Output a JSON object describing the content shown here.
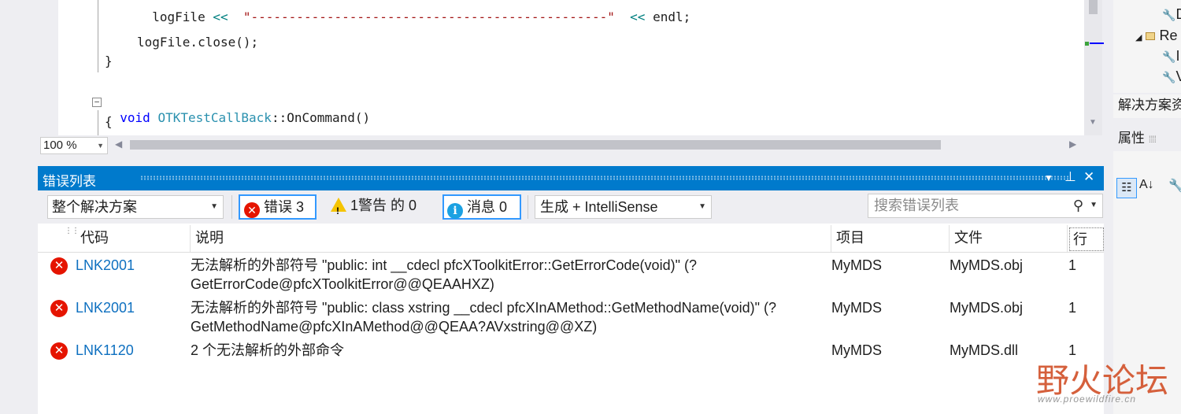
{
  "editor": {
    "lines": [
      {
        "text_ident": "logFile",
        "text_op": "<<",
        "text_dashes": "\"-----------------------------------------------\"",
        "text_op2": "<<",
        "text_end": "endl;"
      },
      {
        "text": "logFile.close();"
      },
      {
        "text": "}"
      },
      {
        "kw": "void",
        "type": "OTKTestCallBack",
        "sep": "::",
        "fn": "OnCommand()"
      },
      {
        "text": "{"
      }
    ],
    "fold_symbol": "−",
    "zoom": "100 %"
  },
  "error_list": {
    "title": "错误列表",
    "scope": "整个解决方案",
    "errors_label": "错误 3",
    "warnings_label": "1警告 的 0",
    "messages_label": "消息 0",
    "build_filter": "生成 + IntelliSense",
    "search_placeholder": "搜索错误列表",
    "columns": [
      "代码",
      "说明",
      "项目",
      "文件",
      "行"
    ],
    "rows": [
      {
        "code": "LNK2001",
        "desc1": "无法解析的外部符号 \"public: int __cdecl pfcXToolkitError::GetErrorCode(void)\" (?",
        "desc2": "GetErrorCode@pfcXToolkitError@@QEAAHXZ)",
        "project": "MyMDS",
        "file": "MyMDS.obj",
        "line": "1"
      },
      {
        "code": "LNK2001",
        "desc1": "无法解析的外部符号 \"public: class xstring __cdecl pfcXInAMethod::GetMethodName(void)\" (?",
        "desc2": "GetMethodName@pfcXInAMethod@@QEAA?AVxstring@@XZ)",
        "project": "MyMDS",
        "file": "MyMDS.obj",
        "line": "1"
      },
      {
        "code": "LNK1120",
        "desc1": "2 个无法解析的外部命令",
        "desc2": "",
        "project": "MyMDS",
        "file": "MyMDS.dll",
        "line": "1"
      }
    ]
  },
  "right_panel": {
    "tree_items": [
      "D",
      "Re",
      "I",
      "V"
    ],
    "solution_tab": "解决方案资",
    "properties_title": "属性"
  },
  "watermark": {
    "brand": "野火论坛",
    "url": "www.proewildfire.cn"
  },
  "colors": {
    "accent": "#007acc",
    "error": "#e51400",
    "link": "#0e70c0",
    "warning": "#f5c400",
    "info": "#1ba1e2"
  }
}
